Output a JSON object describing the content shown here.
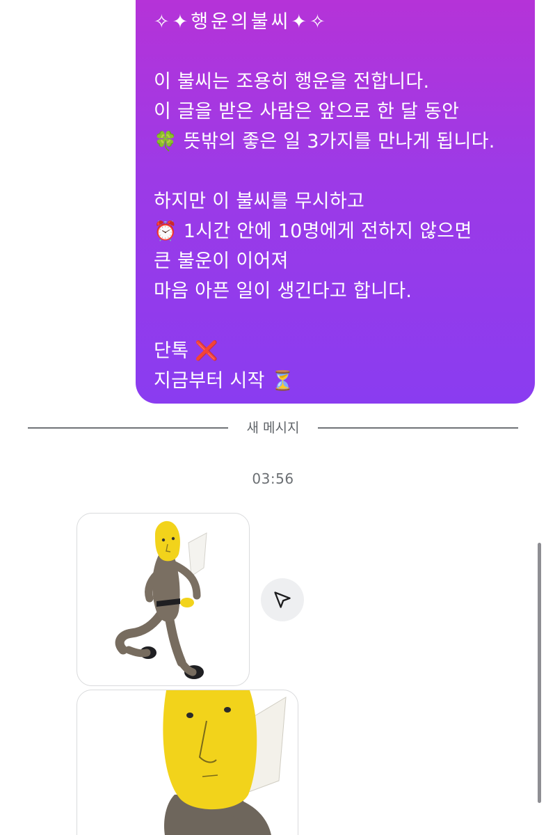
{
  "message": {
    "lines": [
      "✧✦행운의불씨✦✧",
      "",
      "이 불씨는 조용히 행운을 전합니다.",
      "이 글을 받은 사람은 앞으로 한 달 동안",
      "🍀 뜻밖의 좋은 일 3가지를 만나게 됩니다.",
      "",
      "하지만 이 불씨를 무시하고",
      "⏰ 1시간 안에 10명에게 전하지 않으면",
      "큰 불운이 이어져",
      "마음 아픈 일이 생긴다고 합니다.",
      "",
      "단톡 ❌",
      "지금부터 시작 ⏳"
    ],
    "gradient_top": "#b832d6",
    "gradient_bottom": "#8a3cf0"
  },
  "divider": {
    "label": "새 메시지"
  },
  "timestamp": "03:56",
  "attachments": {
    "share_icon": "send-icon",
    "items": [
      {
        "name": "plush-doll-full-photo"
      },
      {
        "name": "plush-doll-closeup-photo"
      }
    ]
  },
  "colors": {
    "background": "#ffffff",
    "plush_yellow": "#f2d31b",
    "plush_body": "#7a6f62"
  }
}
